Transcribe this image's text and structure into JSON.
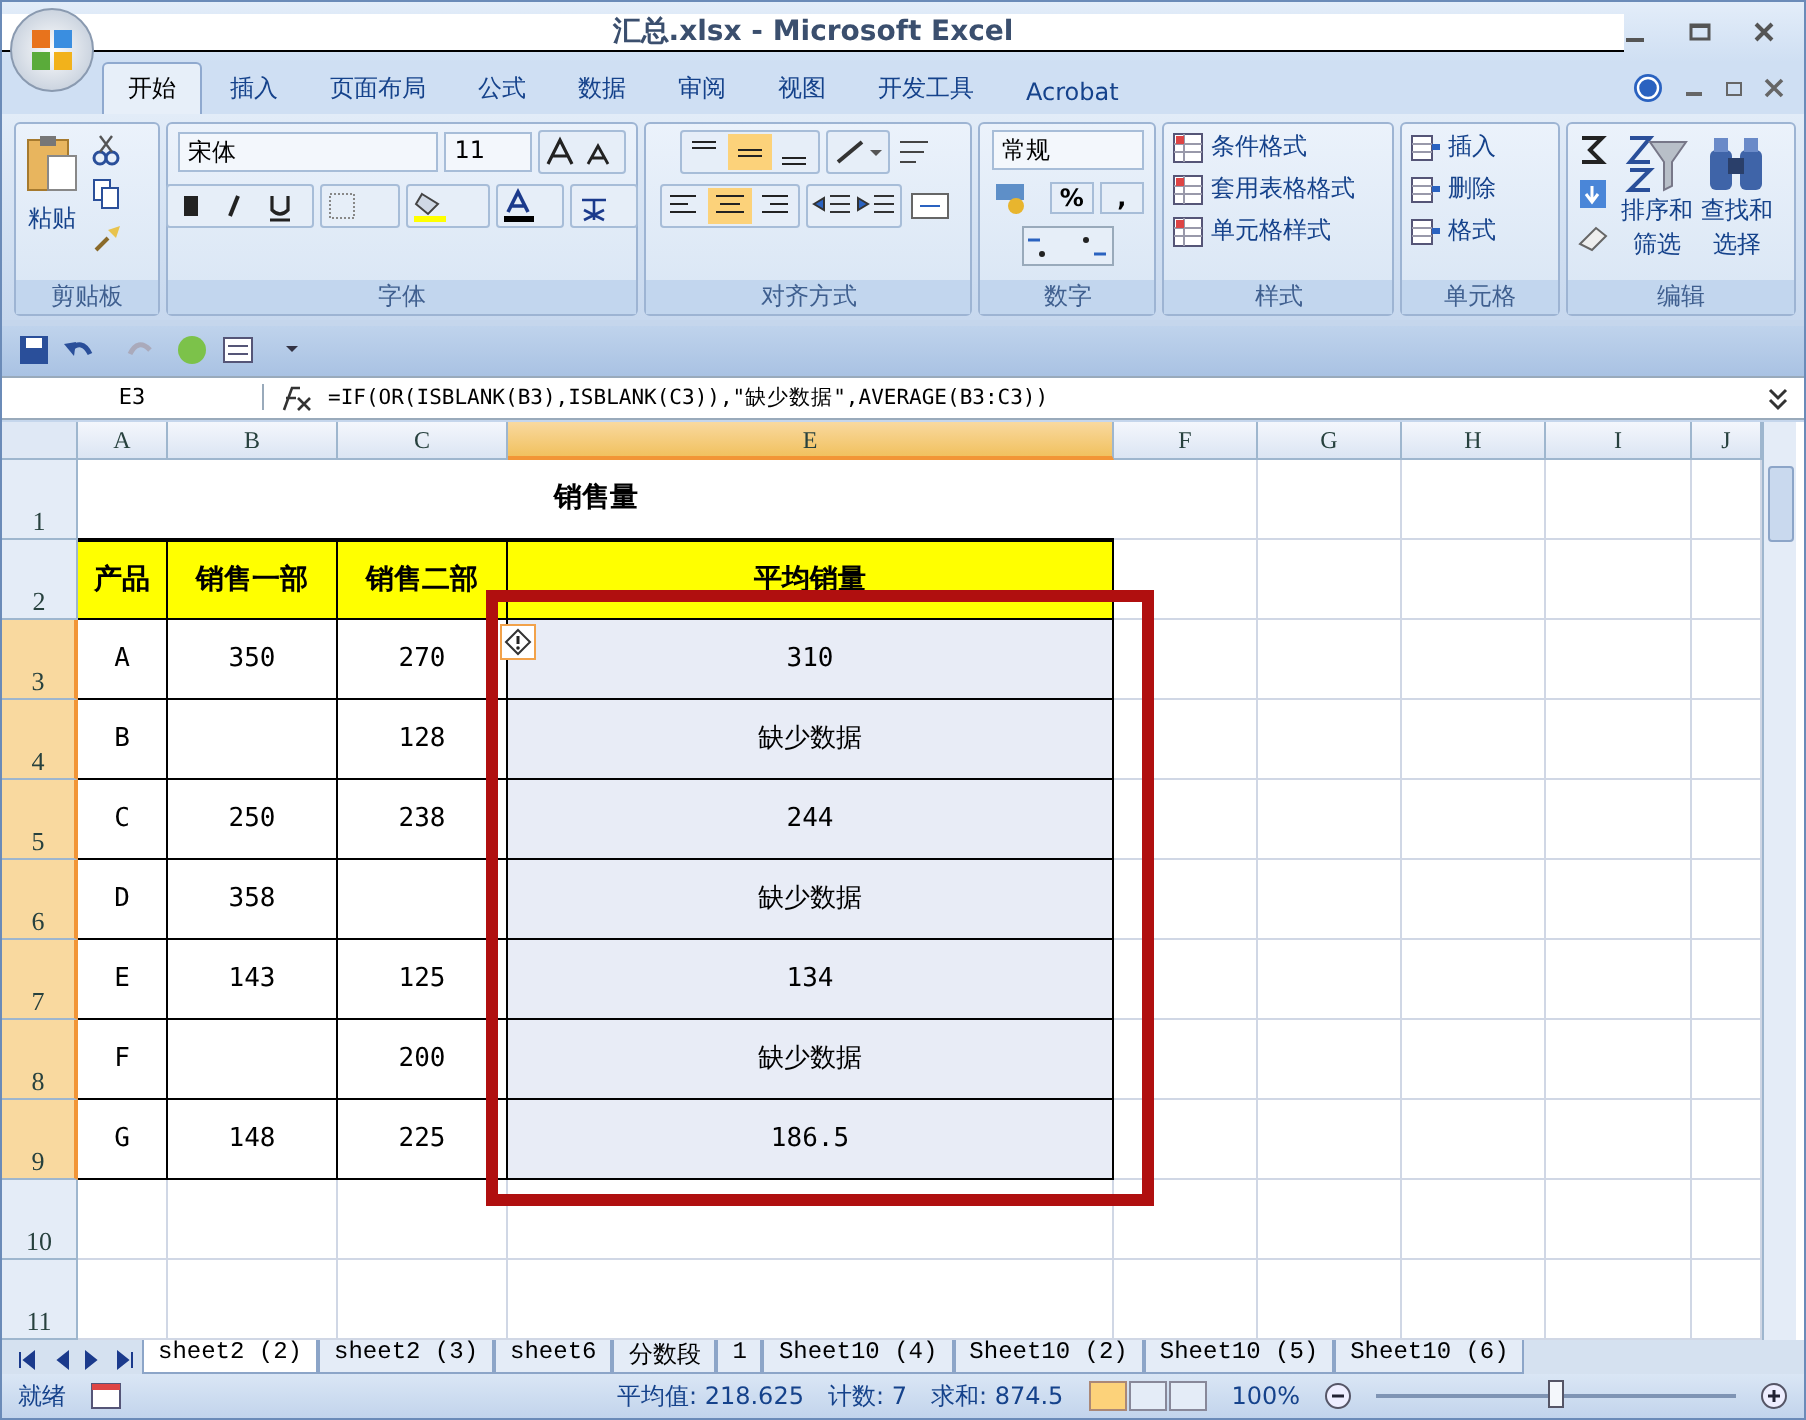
{
  "window": {
    "title": "汇总.xlsx - Microsoft Excel"
  },
  "ribbon_tabs": [
    {
      "label": "开始",
      "selected": true
    },
    {
      "label": "插入",
      "selected": false
    },
    {
      "label": "页面布局",
      "selected": false
    },
    {
      "label": "公式",
      "selected": false
    },
    {
      "label": "数据",
      "selected": false
    },
    {
      "label": "审阅",
      "selected": false
    },
    {
      "label": "视图",
      "selected": false
    },
    {
      "label": "开发工具",
      "selected": false
    },
    {
      "label": "Acrobat",
      "selected": false
    }
  ],
  "clipboard": {
    "label": "剪贴板",
    "paste": "粘贴"
  },
  "font": {
    "label": "字体",
    "name": "宋体",
    "size": "11"
  },
  "alignment": {
    "label": "对齐方式"
  },
  "number": {
    "label": "数字",
    "format": "常规",
    "percent": "%",
    "comma": ","
  },
  "styles": {
    "label": "样式",
    "items": [
      "条件格式",
      "套用表格格式",
      "单元格样式"
    ]
  },
  "cells": {
    "label": "单元格",
    "items": [
      "插入",
      "删除",
      "格式"
    ]
  },
  "editing": {
    "label": "编辑",
    "sort": [
      "排序和",
      "筛选"
    ],
    "find": [
      "查找和",
      "选择"
    ]
  },
  "formula_bar": {
    "name_box": "E3",
    "formula": "=IF(OR(ISBLANK(B3),ISBLANK(C3)),\"缺少数据\",AVERAGE(B3:C3))"
  },
  "columns": [
    {
      "label": "A",
      "selected": false
    },
    {
      "label": "B",
      "selected": false
    },
    {
      "label": "C",
      "selected": false
    },
    {
      "label": "E",
      "selected": true
    },
    {
      "label": "F",
      "selected": false
    },
    {
      "label": "G",
      "selected": false
    },
    {
      "label": "H",
      "selected": false
    },
    {
      "label": "I",
      "selected": false
    },
    {
      "label": "J",
      "selected": false
    }
  ],
  "row_numbers": [
    {
      "label": "1",
      "selected": false
    },
    {
      "label": "2",
      "selected": false
    },
    {
      "label": "3",
      "selected": true
    },
    {
      "label": "4",
      "selected": true
    },
    {
      "label": "5",
      "selected": true
    },
    {
      "label": "6",
      "selected": true
    },
    {
      "label": "7",
      "selected": true
    },
    {
      "label": "8",
      "selected": true
    },
    {
      "label": "9",
      "selected": true
    },
    {
      "label": "10",
      "selected": false
    },
    {
      "label": "11",
      "selected": false
    }
  ],
  "table": {
    "title": "销售量",
    "headers": [
      "产品",
      "销售一部",
      "销售二部",
      "平均销量"
    ],
    "rows": [
      {
        "product": "A",
        "dept1": "350",
        "dept2": "270",
        "average": "310",
        "error_flag": true
      },
      {
        "product": "B",
        "dept1": null,
        "dept2": "128",
        "average": "缺少数据",
        "error_flag": false
      },
      {
        "product": "C",
        "dept1": "250",
        "dept2": "238",
        "average": "244",
        "error_flag": false
      },
      {
        "product": "D",
        "dept1": "358",
        "dept2": null,
        "average": "缺少数据",
        "error_flag": false
      },
      {
        "product": "E",
        "dept1": "143",
        "dept2": "125",
        "average": "134",
        "error_flag": false
      },
      {
        "product": "F",
        "dept1": null,
        "dept2": "200",
        "average": "缺少数据",
        "error_flag": false
      },
      {
        "product": "G",
        "dept1": "148",
        "dept2": "225",
        "average": "186.5",
        "error_flag": false
      }
    ]
  },
  "sheet_tabs": [
    {
      "label": "sheet2 (2)",
      "selected": true
    },
    {
      "label": "sheet2 (3)",
      "selected": false
    },
    {
      "label": "sheet6",
      "selected": false
    },
    {
      "label": "分数段",
      "selected": false
    },
    {
      "label": "1",
      "selected": false
    },
    {
      "label": "Sheet10 (4)",
      "selected": false
    },
    {
      "label": "Sheet10 (2)",
      "selected": false
    },
    {
      "label": "Sheet10 (5)",
      "selected": false
    },
    {
      "label": "Sheet10 (6)",
      "selected": false
    }
  ],
  "status_bar": {
    "ready": "就绪",
    "average": "平均值: 218.625",
    "count": "计数: 7",
    "sum": "求和: 874.5",
    "zoom": "100%",
    "zoom_slider": {
      "level": 0.5
    }
  }
}
